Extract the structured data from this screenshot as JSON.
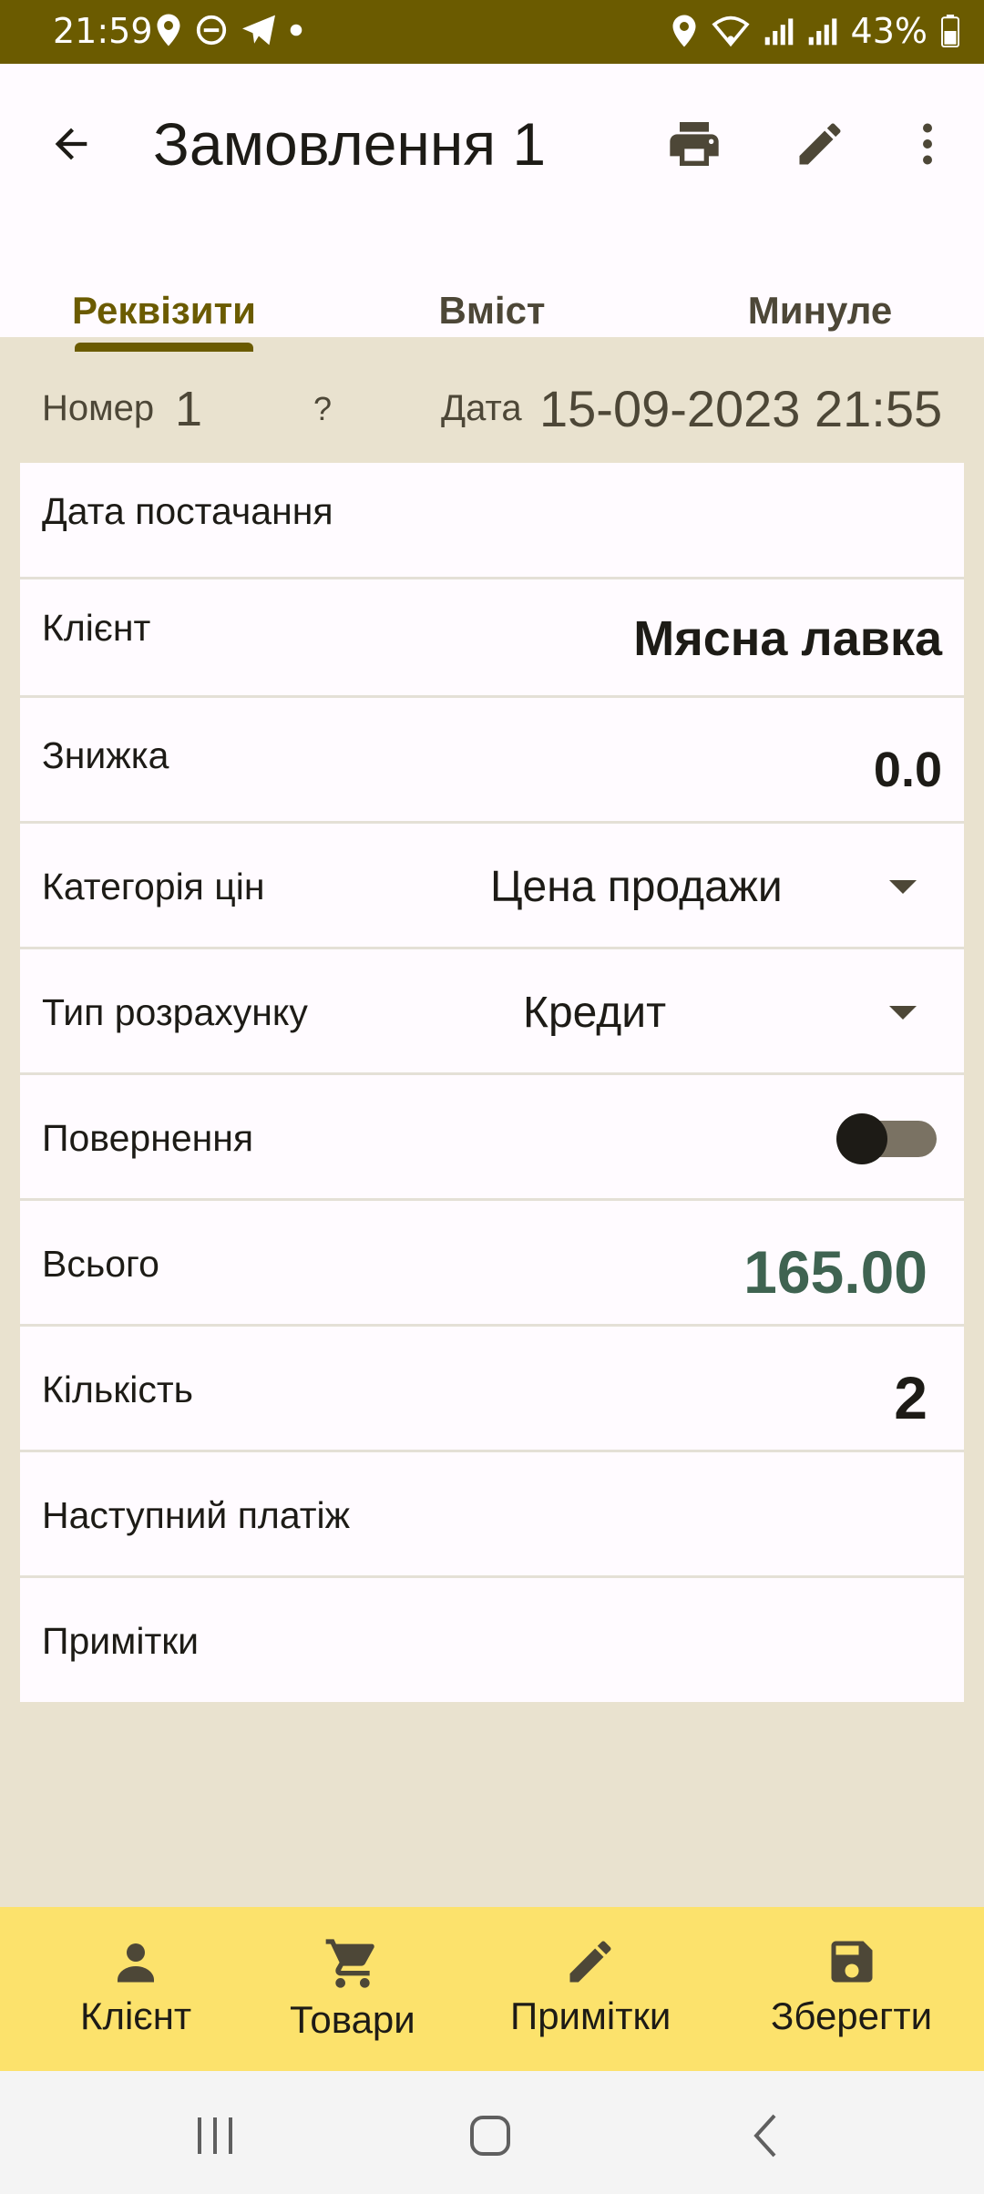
{
  "status_bar": {
    "time": "21:59",
    "battery": "43%",
    "icons_left": [
      "location-icon",
      "do-not-disturb-icon",
      "telegram-icon",
      "dot-icon"
    ],
    "icons_right": [
      "location-icon",
      "wifi-icon",
      "signal-icon",
      "signal-icon",
      "battery-icon"
    ]
  },
  "app_bar": {
    "title": "Замовлення 1",
    "actions": [
      "print-icon",
      "edit-icon",
      "more-vert-icon"
    ]
  },
  "tabs": [
    {
      "label": "Реквізити",
      "active": true
    },
    {
      "label": "Вміст",
      "active": false
    },
    {
      "label": "Минуле",
      "active": false
    }
  ],
  "info": {
    "number_label": "Номер",
    "number_value": "1",
    "help": "?",
    "date_label": "Дата",
    "date_value": "15-09-2023 21:55"
  },
  "form": {
    "delivery_date_label": "Дата постачання",
    "client_label": "Клієнт",
    "client_value": "Мясна лавка",
    "discount_label": "Знижка",
    "discount_value": "0.0",
    "price_category_label": "Категорія цін",
    "price_category_value": "Цена продажи",
    "payment_type_label": "Тип розрахунку",
    "payment_type_value": "Кредит",
    "return_label": "Повернення",
    "return_on": false,
    "total_label": "Всього",
    "total_value": "165.00",
    "quantity_label": "Кількість",
    "quantity_value": "2",
    "next_payment_label": "Наступний платіж",
    "notes_label": "Примітки"
  },
  "bottom_nav": [
    {
      "label": "Клієнт",
      "icon": "person-icon"
    },
    {
      "label": "Товари",
      "icon": "cart-icon"
    },
    {
      "label": "Примітки",
      "icon": "edit-icon"
    },
    {
      "label": "Зберегти",
      "icon": "save-icon"
    }
  ],
  "colors": {
    "primary": "#6b5b00",
    "background": "#e9e2cf",
    "total": "#3f6351",
    "bottom_nav": "#fce26c"
  }
}
